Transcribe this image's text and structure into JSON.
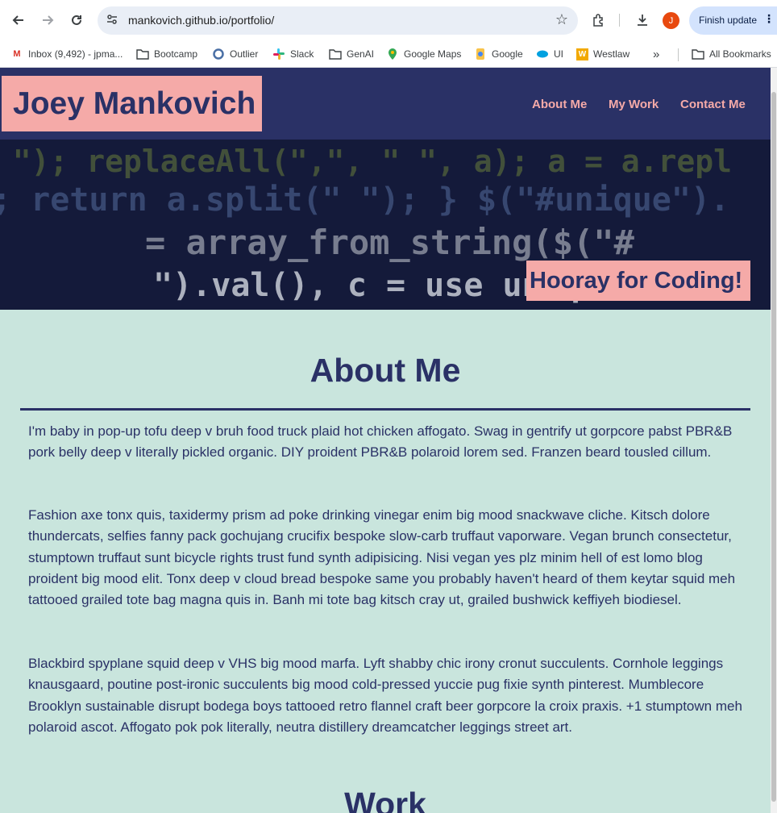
{
  "browser": {
    "url": "mankovich.github.io/portfolio/",
    "avatar_initial": "J",
    "finish_update_label": "Finish update",
    "bookmarks": [
      {
        "label": "Inbox (9,492) - jpma...",
        "icon": "gmail-icon"
      },
      {
        "label": "Bootcamp",
        "icon": "folder-icon"
      },
      {
        "label": "Outlier",
        "icon": "outlier-icon"
      },
      {
        "label": "Slack",
        "icon": "slack-icon"
      },
      {
        "label": "GenAI",
        "icon": "folder-icon"
      },
      {
        "label": "Google Maps",
        "icon": "maps-icon"
      },
      {
        "label": "Google",
        "icon": "google-icon"
      },
      {
        "label": "UI",
        "icon": "salesforce-icon"
      },
      {
        "label": "Westlaw",
        "icon": "westlaw-icon"
      }
    ],
    "all_bookmarks_label": "All Bookmarks"
  },
  "site": {
    "title": "Joey Mankovich",
    "nav": [
      "About Me",
      "My Work",
      "Contact Me"
    ],
    "hero_tagline": "Hooray for Coding!",
    "hero_code_lines": [
      "\" \"); replaceAll(\",\", \" \", a); a = a.repl",
      "; return a.split(\" \"); } $(\"#unique\").",
      "= array_from_string($(\"#",
      "\").val(), c = use unique("
    ],
    "about": {
      "heading": "About Me",
      "paragraphs": [
        "I'm baby in pop-up tofu deep v bruh food truck plaid hot chicken affogato. Swag in gentrify ut gorpcore pabst PBR&B pork belly deep v literally pickled organic. DIY proident PBR&B polaroid lorem sed. Franzen beard tousled cillum.",
        "Fashion axe tonx quis, taxidermy prism ad poke drinking vinegar enim big mood snackwave cliche. Kitsch dolore thundercats, selfies fanny pack gochujang crucifix bespoke slow-carb truffaut vaporware. Vegan brunch consectetur, stumptown truffaut sunt bicycle rights trust fund synth adipisicing. Nisi vegan yes plz minim hell of est lomo blog proident big mood elit. Tonx deep v cloud bread bespoke same you probably haven't heard of them keytar squid meh tattooed grailed tote bag magna quis in. Banh mi tote bag kitsch cray ut, grailed bushwick keffiyeh biodiesel.",
        "Blackbird spyplane squid deep v VHS big mood marfa. Lyft shabby chic irony cronut succulents. Cornhole leggings knausgaard, poutine post-ironic succulents big mood cold-pressed yuccie pug fixie synth pinterest. Mumblecore Brooklyn sustainable disrupt bodega boys tattooed retro flannel craft beer gorpcore la croix praxis. +1 stumptown meh polaroid ascot. Affogato pok pok literally, neutra distillery dreamcatcher leggings street art."
      ]
    },
    "work_heading": "Work"
  },
  "colors": {
    "navy": "#2a3166",
    "pink": "#f5aaa8",
    "mint": "#c9e5dd"
  }
}
